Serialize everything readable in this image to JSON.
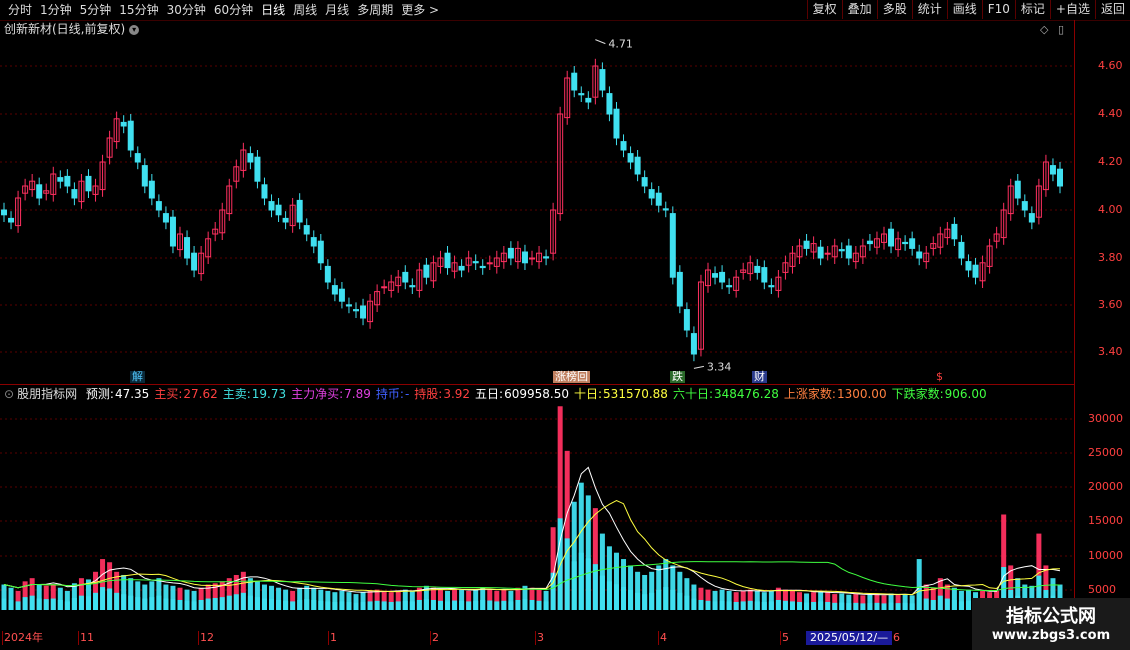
{
  "toolbar": {
    "periods": [
      "分时",
      "1分钟",
      "5分钟",
      "15分钟",
      "30分钟",
      "60分钟",
      "日线",
      "周线",
      "月线",
      "多周期",
      "更多 >"
    ],
    "active_period": "日线",
    "buttons": [
      "复权",
      "叠加",
      "多股",
      "统计",
      "画线",
      "F10",
      "标记",
      "+自选",
      "返回"
    ]
  },
  "chart_title": "创新新材(日线,前复权)",
  "price_axis": [
    "4.60",
    "4.40",
    "4.20",
    "4.00",
    "3.80",
    "3.60",
    "3.40"
  ],
  "price_annotations": {
    "high": "4.71",
    "low": "3.34"
  },
  "events": [
    {
      "label": "解",
      "color": "#4fc3f7",
      "bg": "#0a2a3a"
    },
    {
      "label": "涨榜回",
      "color": "#fff",
      "bg": "#c08060"
    },
    {
      "label": "跌",
      "color": "#fff",
      "bg": "#2a6a2a"
    },
    {
      "label": "财",
      "color": "#fff",
      "bg": "#2a3a8a"
    },
    {
      "label": "$",
      "color": "#ff4040",
      "bg": "transparent"
    }
  ],
  "indicator": {
    "name": "股朋指标网",
    "items": [
      {
        "label": "预测:",
        "value": "47.35",
        "color": "#ffffff"
      },
      {
        "label": "主买:",
        "value": "27.62",
        "color": "#ff4040"
      },
      {
        "label": "主卖:",
        "value": "19.73",
        "color": "#40e0e0"
      },
      {
        "label": "主力净买:",
        "value": "7.89",
        "color": "#e040e0"
      },
      {
        "label": "持币:",
        "value": "-",
        "color": "#4060ff"
      },
      {
        "label": "持股:",
        "value": "3.92",
        "color": "#ff4040"
      },
      {
        "label": "五日:",
        "value": "609958.50",
        "color": "#ffffff"
      },
      {
        "label": "十日:",
        "value": "531570.88",
        "color": "#ffff40"
      },
      {
        "label": "六十日:",
        "value": "348476.28",
        "color": "#40ff40"
      },
      {
        "label": "上涨家数:",
        "value": "1300.00",
        "color": "#ff8040"
      },
      {
        "label": "下跌家数:",
        "value": "906.00",
        "color": "#40ff40"
      }
    ]
  },
  "volume_axis": [
    "30000",
    "25000",
    "20000",
    "15000",
    "10000",
    "5000"
  ],
  "time_axis": [
    "2024年",
    "11",
    "12",
    "1",
    "2",
    "3",
    "4",
    "5",
    "6"
  ],
  "cursor_date": "2025/05/12/—",
  "watermark": {
    "title": "指标公式网",
    "url": "www.zbgs3.com"
  },
  "colors": {
    "up": "#ff3060",
    "down": "#40e0f0",
    "axis": "#ff4040",
    "grid": "#8b0000"
  }
}
